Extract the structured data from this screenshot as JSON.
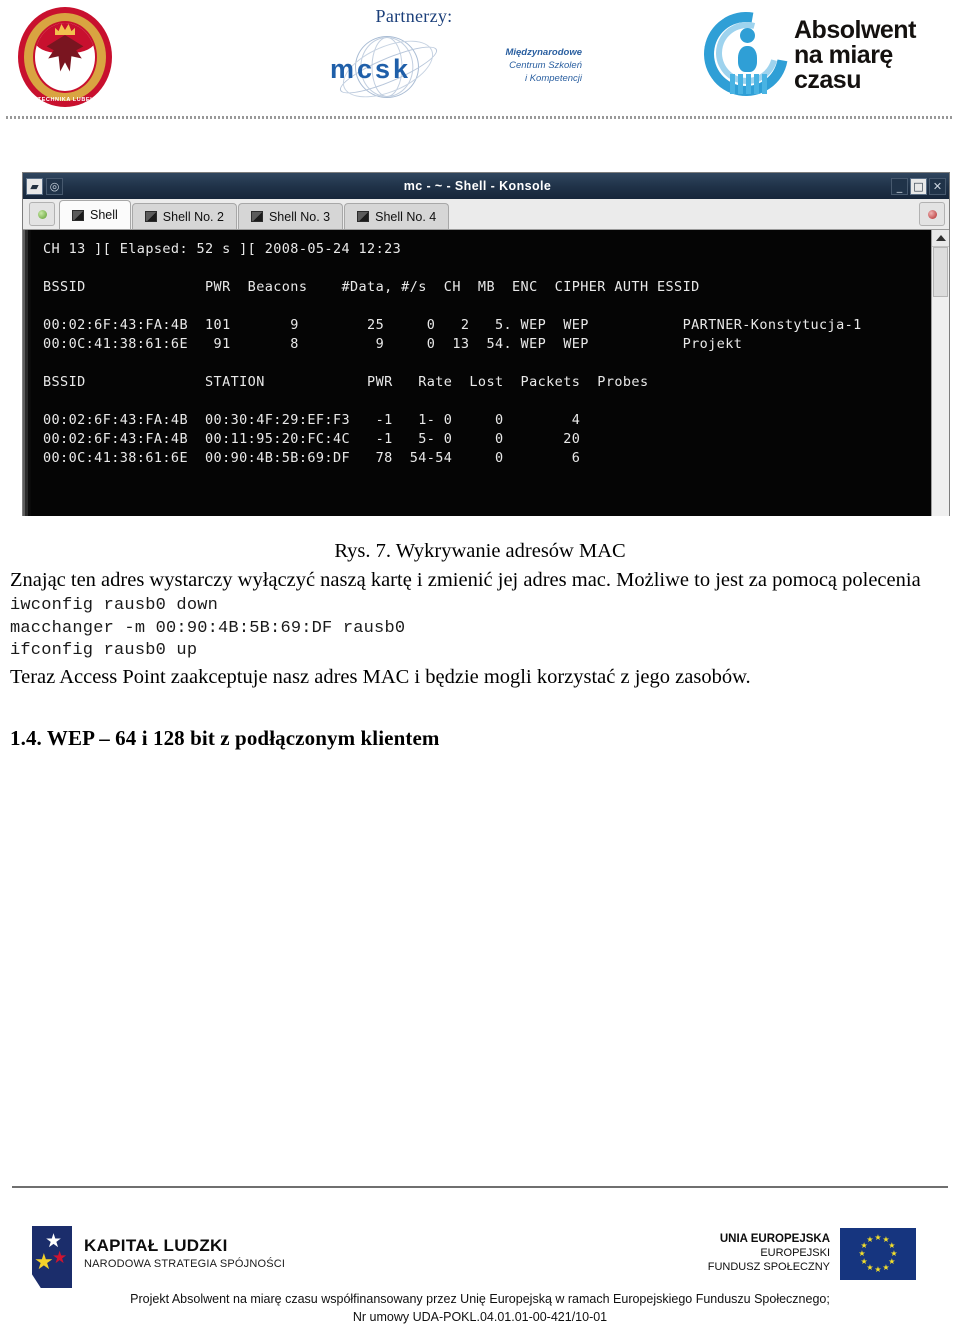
{
  "header": {
    "partners_label": "Partnerzy:",
    "university_seal": {
      "name": "politechnika-lubelska-seal",
      "caption": "POLITECHNIKA LUBELSKA"
    },
    "mcsk": {
      "wordmark": "mcsk",
      "line1": "Międzynarodowe",
      "line2": "Centrum Szkoleń",
      "line3": "i Kompetencji"
    },
    "absolwent": {
      "line1": "Absolwent",
      "line2": "na miarę",
      "line3": "czasu"
    }
  },
  "konsole": {
    "title": "mc - ~ - Shell - Konsole",
    "titlebar_buttons": {
      "menu": "▰",
      "settings": "◎",
      "minimize": "_",
      "maximize": "□",
      "close": "✕"
    },
    "new_tab_button": "new-tab",
    "close_tab_button": "close-tab",
    "tabs": [
      {
        "label": "Shell",
        "active": true
      },
      {
        "label": "Shell No. 2",
        "active": false
      },
      {
        "label": "Shell No. 3",
        "active": false
      },
      {
        "label": "Shell No. 4",
        "active": false
      }
    ],
    "screen": {
      "status_line": "CH 13 ][ Elapsed: 52 s ][ 2008-05-24 12:23",
      "ap_header": "BSSID              PWR  Beacons    #Data, #/s  CH  MB  ENC  CIPHER AUTH ESSID",
      "ap_rows": [
        "00:02:6F:43:FA:4B  101       9        25     0   2   5. WEP  WEP           PARTNER-Konstytucja-1",
        "00:0C:41:38:61:6E   91       8         9     0  13  54. WEP  WEP           Projekt"
      ],
      "sta_header": "BSSID              STATION            PWR   Rate  Lost  Packets  Probes",
      "sta_rows": [
        "00:02:6F:43:FA:4B  00:30:4F:29:EF:F3   -1   1- 0     0        4",
        "00:02:6F:43:FA:4B  00:11:95:20:FC:4C   -1   5- 0     0       20",
        "00:0C:41:38:61:6E  00:90:4B:5B:69:DF   78  54-54     0        6"
      ]
    }
  },
  "document": {
    "figure_caption": "Rys. 7. Wykrywanie adresów MAC",
    "paragraph": "Znając ten adres wystarczy wyłączyć naszą kartę i zmienić jej adres mac. Możliwe to jest za pomocą polecenia",
    "code_lines": [
      "iwconfig rausb0 down",
      "macchanger -m 00:90:4B:5B:69:DF rausb0",
      "ifconfig rausb0 up"
    ],
    "paragraph_after": "Teraz Access Point zaakceptuje nasz adres MAC i będzie mogli korzystać z jego zasobów.",
    "section_heading": "1.4. WEP – 64 i 128 bit z podłączonym klientem"
  },
  "footer": {
    "kapital": {
      "title": "KAPITAŁ LUDZKI",
      "subtitle": "NARODOWA STRATEGIA SPÓJNOŚCI"
    },
    "eu": {
      "line1": "UNIA EUROPEJSKA",
      "line2": "EUROPEJSKI",
      "line3": "FUNDUSZ SPOŁECZNY"
    },
    "text_line1": "Projekt Absolwent na miarę czasu współfinansowany przez Unię Europejską w ramach Europejskiego Funduszu Społecznego;",
    "text_line2": "Nr umowy UDA-POKL.04.01.01-00-421/10-01"
  },
  "colors": {
    "brand_blue": "#1f5fa9",
    "absolwent_blue": "#2f9fd6",
    "seal_red": "#c8102e",
    "eu_blue": "#16357f",
    "terminal_bg": "#050505",
    "titlebar": "#203349"
  }
}
